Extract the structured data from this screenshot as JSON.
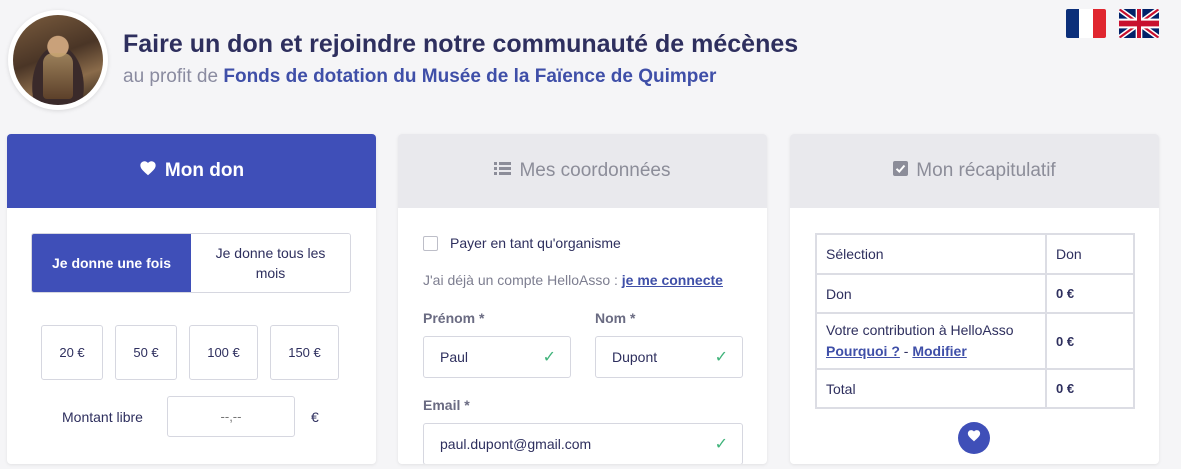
{
  "header": {
    "title": "Faire un don et rejoindre notre communauté de mécènes",
    "subtitle_prefix": "au profit de",
    "organization": "Fonds de dotation du Musée de la Faïence de Quimper"
  },
  "languages": [
    {
      "name": "Français",
      "icon": "flag-fr-icon"
    },
    {
      "name": "English",
      "icon": "flag-uk-icon"
    }
  ],
  "steps": {
    "don": {
      "label": "Mon don",
      "icon": "heart-icon"
    },
    "coordonnees": {
      "label": "Mes coordonnées",
      "icon": "list-icon"
    },
    "recap": {
      "label": "Mon récapitulatif",
      "icon": "check-square-icon"
    }
  },
  "donation": {
    "frequency_once": "Je donne une fois",
    "frequency_monthly": "Je donne tous les mois",
    "amounts": [
      "20 €",
      "50 €",
      "100 €",
      "150 €"
    ],
    "free_amount_label": "Montant libre",
    "free_amount_placeholder": "--,--",
    "currency": "€"
  },
  "coordonnees": {
    "organism_checkbox": "Payer en tant qu'organisme",
    "account_text": "J'ai déjà un compte HelloAsso :",
    "account_link": "je me connecte",
    "firstname_label": "Prénom *",
    "firstname_value": "Paul",
    "lastname_label": "Nom *",
    "lastname_value": "Dupont",
    "email_label": "Email *",
    "email_value": "paul.dupont@gmail.com"
  },
  "recap": {
    "col_selection": "Sélection",
    "col_don": "Don",
    "row_don_label": "Don",
    "row_don_value": "0 €",
    "row_contrib_label": "Votre contribution à HelloAsso",
    "row_contrib_why": "Pourquoi ?",
    "row_contrib_sep": "-",
    "row_contrib_modify": "Modifier",
    "row_contrib_value": "0 €",
    "row_total_label": "Total",
    "row_total_value": "0 €"
  },
  "colors": {
    "primary": "#3f4fb8",
    "valid": "#3fb37a"
  }
}
